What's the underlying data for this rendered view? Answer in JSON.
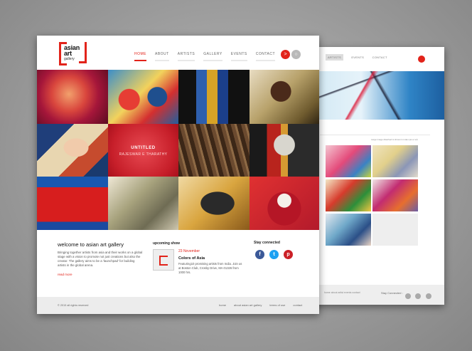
{
  "front": {
    "logo": {
      "word1": "asian",
      "word2": "art",
      "word3": "gallery"
    },
    "nav": [
      {
        "label": "HOME",
        "active": true
      },
      {
        "label": "ABOUT",
        "active": false
      },
      {
        "label": "ARTISTS",
        "active": false
      },
      {
        "label": "GALLERY",
        "active": false
      },
      {
        "label": "EVENTS",
        "active": false
      },
      {
        "label": "CONTACT",
        "active": false
      }
    ],
    "icons": {
      "share": ">",
      "search": "○"
    },
    "featured": {
      "title": "UNTITLED",
      "artist": "RAJESWAR E THARATHY"
    },
    "welcome": {
      "heading": "welcome to asian art gallery",
      "text": "Bringing together artists from asia and their works on a global stage with a vision to promote not just creations but also the creator. The gallery aims to be a 'launchpad' for building artists in the global arena.",
      "readmore": "read more"
    },
    "upcoming": {
      "heading": "upcoming show",
      "date": "23 November",
      "title": "Colors of Asia",
      "desc": "Featuring10 promising artists from India. Join us at Boston Club, Crosby Drive, MA 01326 from 1000 hrs."
    },
    "stay": {
      "heading": "Stay connected",
      "facebook": "f",
      "twitter": "t",
      "pinterest": "p"
    },
    "footer": {
      "copyright": "© 2013 all rights reserved",
      "links": [
        "home",
        "about asian art gallery",
        "terms of use",
        "contact"
      ]
    }
  },
  "back": {
    "nav": [
      "ARTISTS",
      "EVENTS",
      "CONTACT"
    ],
    "caption": "Large image Attached & shown in index (as a ref)",
    "footer": {
      "links": "home  about  artist  events  contact",
      "stay": "Stay Connected :"
    }
  },
  "colors": {
    "brand": "#e2231a",
    "facebook": "#3b5998",
    "twitter": "#1da1f2",
    "pinterest": "#cb2027"
  }
}
